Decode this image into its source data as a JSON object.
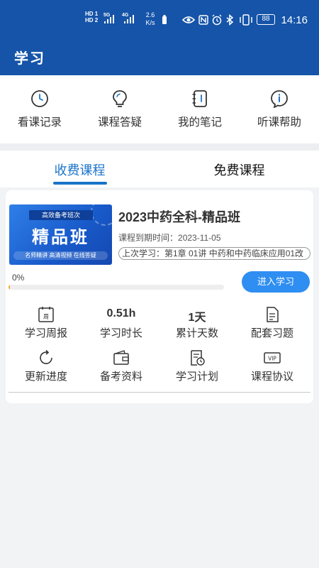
{
  "status_bar": {
    "sig1": "HD 1",
    "sig2": "HD 2",
    "net_a": "5G",
    "net_b": "4G",
    "speed_value": "2.6",
    "speed_unit": "K/s",
    "battery": "88",
    "time": "14:16"
  },
  "app": {
    "title": "学习"
  },
  "quick_actions": [
    {
      "label": "看课记录",
      "icon": "clock-icon"
    },
    {
      "label": "课程答疑",
      "icon": "lightbulb-icon"
    },
    {
      "label": "我的笔记",
      "icon": "notebook-icon"
    },
    {
      "label": "听课帮助",
      "icon": "info-icon"
    }
  ],
  "tabs": {
    "paid": "收费课程",
    "free": "免费课程",
    "active": "paid"
  },
  "course": {
    "banner": {
      "ribbon": "高效备考班次",
      "big": "精品班",
      "footer": "名师精讲 高清视频 在线答疑"
    },
    "title": "2023中药全科-精品班",
    "expire_label": "课程到期时间：",
    "expire_date": "2023-11-05",
    "last_study": "上次学习：第1章 01讲 中药和中药临床应用01改",
    "progress_text": "0%",
    "progress_fraction": 0.0,
    "enter_button": "进入学习"
  },
  "stats": [
    {
      "label": "学习周报",
      "icon": "calendar-week-icon",
      "icon_text": "周"
    },
    {
      "label": "学习时长",
      "value": "0.51h"
    },
    {
      "label": "累计天数",
      "value": "1天"
    },
    {
      "label": "配套习题",
      "icon": "document-icon"
    },
    {
      "label": "更新进度",
      "icon": "refresh-icon"
    },
    {
      "label": "备考资料",
      "icon": "wallet-icon"
    },
    {
      "label": "学习计划",
      "icon": "plan-icon"
    },
    {
      "label": "课程协议",
      "icon": "vip-icon",
      "icon_text": "VIP"
    }
  ],
  "colors": {
    "brand": "#1554a8",
    "accent": "#1b74c9",
    "button": "#2e8ef2"
  }
}
